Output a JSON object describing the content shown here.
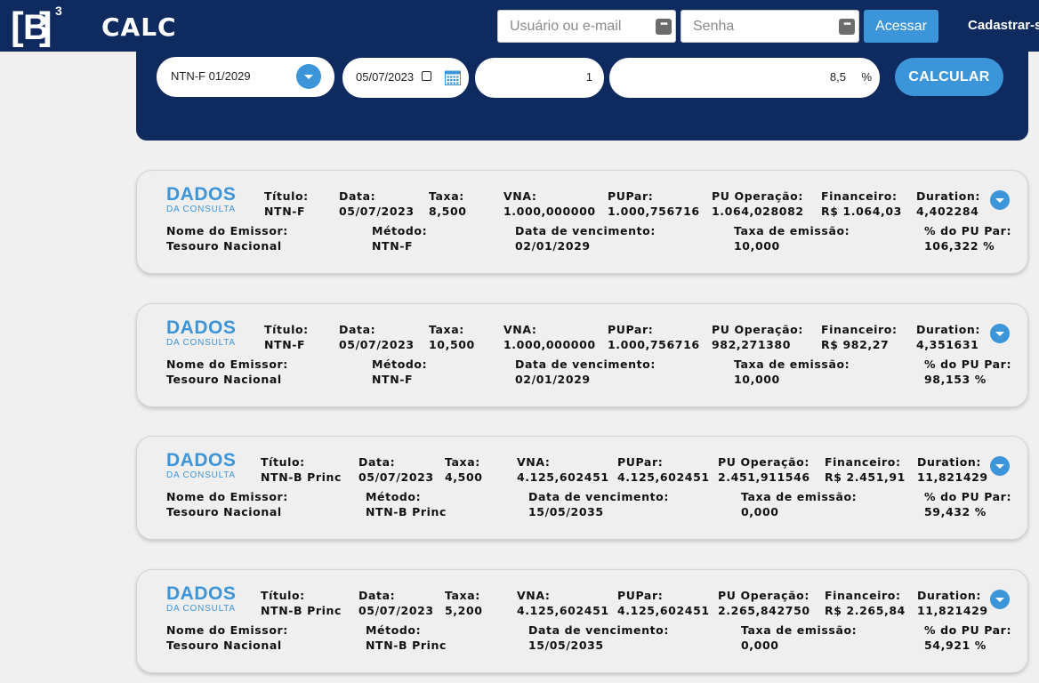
{
  "header": {
    "logo_letter": "B",
    "logo_superscript": "3",
    "app_title": "CALC",
    "user_placeholder": "Usuário ou e-mail",
    "password_placeholder": "Senha",
    "login_button": "Acessar",
    "register_link": "Cadastrar-s",
    "password_manager_glyph": "•••"
  },
  "form": {
    "titulo_selected": "NTN-F 01/2029",
    "data_value": "05/07/2023",
    "quantidade": "1",
    "taxa": "8,5",
    "taxa_unit": "%",
    "calcular_button": "CALCULAR"
  },
  "card_brand": {
    "line1": "DADOS",
    "line2": "DA CONSULTA"
  },
  "labels": {
    "titulo": "Título:",
    "data": "Data:",
    "taxa": "Taxa:",
    "vna": "VNA:",
    "pupar": "PUPar:",
    "pu_operacao": "PU Operação:",
    "financeiro": "Financeiro:",
    "duration": "Duration:",
    "emissor": "Nome do Emissor:",
    "metodo": "Método:",
    "vencimento": "Data de vencimento:",
    "taxa_emissao": "Taxa de emissão:",
    "pct_pu_par": "% do PU Par:"
  },
  "results": [
    {
      "titulo": "NTN-F",
      "data": "05/07/2023",
      "taxa": "8,500",
      "vna": "1.000,000000",
      "pupar": "1.000,756716",
      "pu_operacao": "1.064,028082",
      "financeiro": "R$ 1.064,03",
      "duration": "4,402284",
      "emissor": "Tesouro Nacional",
      "metodo": "NTN-F",
      "vencimento": "02/01/2029",
      "taxa_emissao": "10,000",
      "pct_pu_par": "106,322 %"
    },
    {
      "titulo": "NTN-F",
      "data": "05/07/2023",
      "taxa": "10,500",
      "vna": "1.000,000000",
      "pupar": "1.000,756716",
      "pu_operacao": "982,271380",
      "financeiro": "R$ 982,27",
      "duration": "4,351631",
      "emissor": "Tesouro Nacional",
      "metodo": "NTN-F",
      "vencimento": "02/01/2029",
      "taxa_emissao": "10,000",
      "pct_pu_par": "98,153 %"
    },
    {
      "titulo": "NTN-B Princ",
      "data": "05/07/2023",
      "taxa": "4,500",
      "vna": "4.125,602451",
      "pupar": "4.125,602451",
      "pu_operacao": "2.451,911546",
      "financeiro": "R$ 2.451,91",
      "duration": "11,821429",
      "emissor": "Tesouro Nacional",
      "metodo": "NTN-B Princ",
      "vencimento": "15/05/2035",
      "taxa_emissao": "0,000",
      "pct_pu_par": "59,432 %"
    },
    {
      "titulo": "NTN-B Princ",
      "data": "05/07/2023",
      "taxa": "5,200",
      "vna": "4.125,602451",
      "pupar": "4.125,602451",
      "pu_operacao": "2.265,842750",
      "financeiro": "R$ 2.265,84",
      "duration": "11,821429",
      "emissor": "Tesouro Nacional",
      "metodo": "NTN-B Princ",
      "vencimento": "15/05/2035",
      "taxa_emissao": "0,000",
      "pct_pu_par": "54,921 %"
    }
  ],
  "colors": {
    "navy": "#0f2a5f",
    "accent_blue": "#3d95d9",
    "page_bg": "#f0f0f0"
  }
}
